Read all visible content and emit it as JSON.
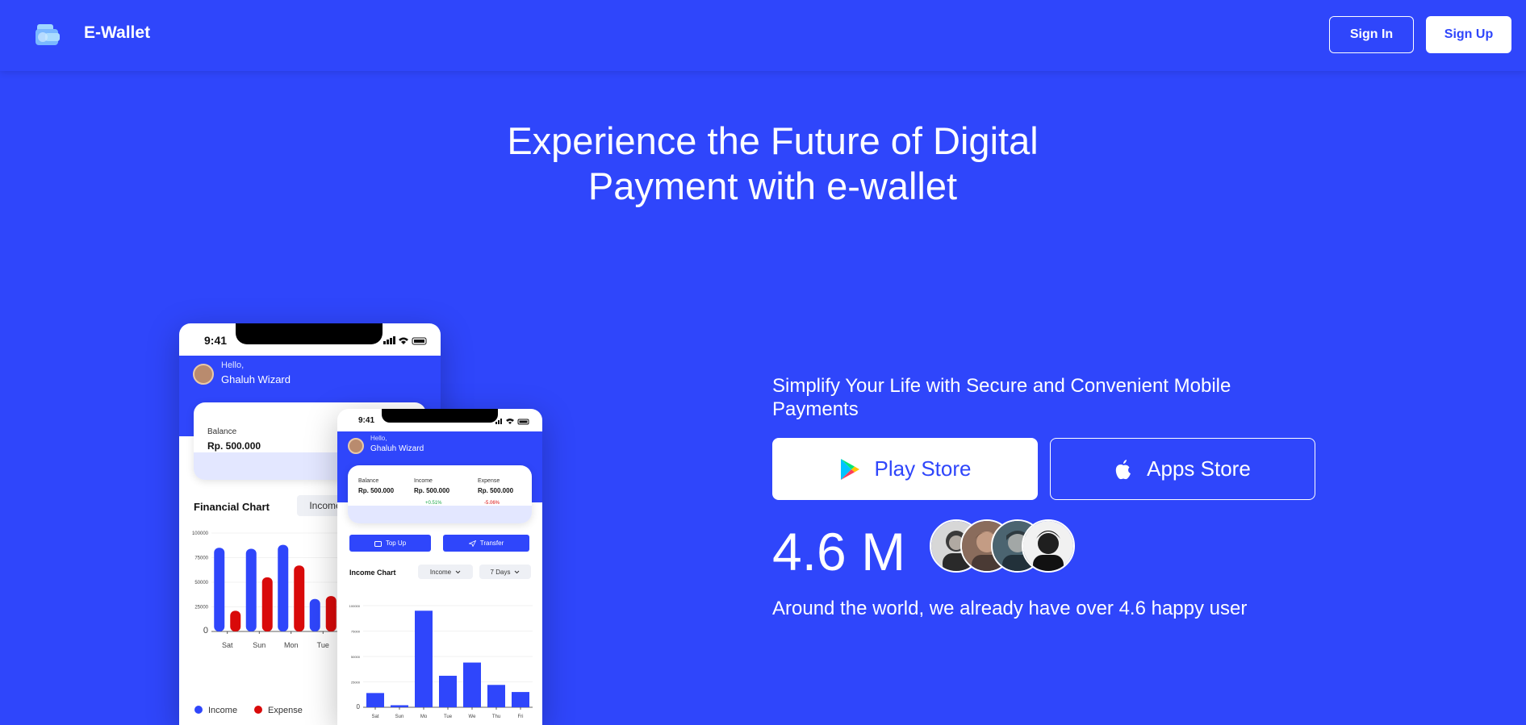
{
  "nav": {
    "brand": "E-Wallet",
    "sign_in": "Sign In",
    "sign_up": "Sign Up"
  },
  "hero": {
    "title_line1": "Experience the Future of Digital",
    "title_line2": "Payment with e-wallet",
    "subtitle": "Simplify Your Life with Secure and Convenient Mobile Payments",
    "play_store": "Play Store",
    "apps_store": "Apps Store",
    "users_count": "4.6 M",
    "tagline": "Around the world, we already have over 4.6 happy user"
  },
  "phone_back": {
    "time": "9:41",
    "hello": "Hello,",
    "user": "Ghaluh Wizard",
    "balance_label": "Balance",
    "balance_value": "Rp. 500.000",
    "chart_title": "Financial Chart",
    "chart_filter": "Income",
    "legend_income": "Income",
    "legend_expense": "Expense"
  },
  "phone_front": {
    "time": "9:41",
    "hello": "Hello,",
    "user": "Ghaluh Wizard",
    "balance_label": "Balance",
    "balance_value": "Rp. 500.000",
    "income_label": "Income",
    "income_value": "Rp. 500.000",
    "income_change": "+0.51%",
    "expense_label": "Expense",
    "expense_value": "Rp. 500.000",
    "expense_change": "-5.06%",
    "top_up": "Top Up",
    "transfer": "Transfer",
    "chart_title": "Income Chart",
    "chart_filter": "Income",
    "chart_period": "7 Days"
  },
  "chart_data": [
    {
      "type": "bar",
      "title": "Financial Chart",
      "categories": [
        "Sat",
        "Sun",
        "Mon",
        "Tue"
      ],
      "yticks": [
        "0",
        "25000",
        "50000",
        "75000",
        "100000"
      ],
      "ylim": [
        0,
        100000
      ],
      "series": [
        {
          "name": "Income",
          "color": "#2f46fb",
          "values": [
            85000,
            84000,
            88000,
            33000
          ]
        },
        {
          "name": "Expense",
          "color": "#d90a0a",
          "values": [
            21000,
            55000,
            67000,
            36000
          ]
        }
      ]
    },
    {
      "type": "bar",
      "title": "Income Chart",
      "categories": [
        "Sat",
        "Sun",
        "Mo",
        "Tue",
        "We",
        "Thu",
        "Fri"
      ],
      "yticks": [
        "0",
        "25000",
        "50000",
        "75000",
        "100000"
      ],
      "ylim": [
        0,
        100000
      ],
      "series": [
        {
          "color": "#2f46fb",
          "values": [
            14000,
            2000,
            95000,
            31000,
            44000,
            22000,
            15000
          ]
        }
      ]
    }
  ],
  "colors": {
    "brand_blue": "#2f46fb",
    "expense_red": "#d90a0a",
    "income_green": "#1ea84a"
  }
}
